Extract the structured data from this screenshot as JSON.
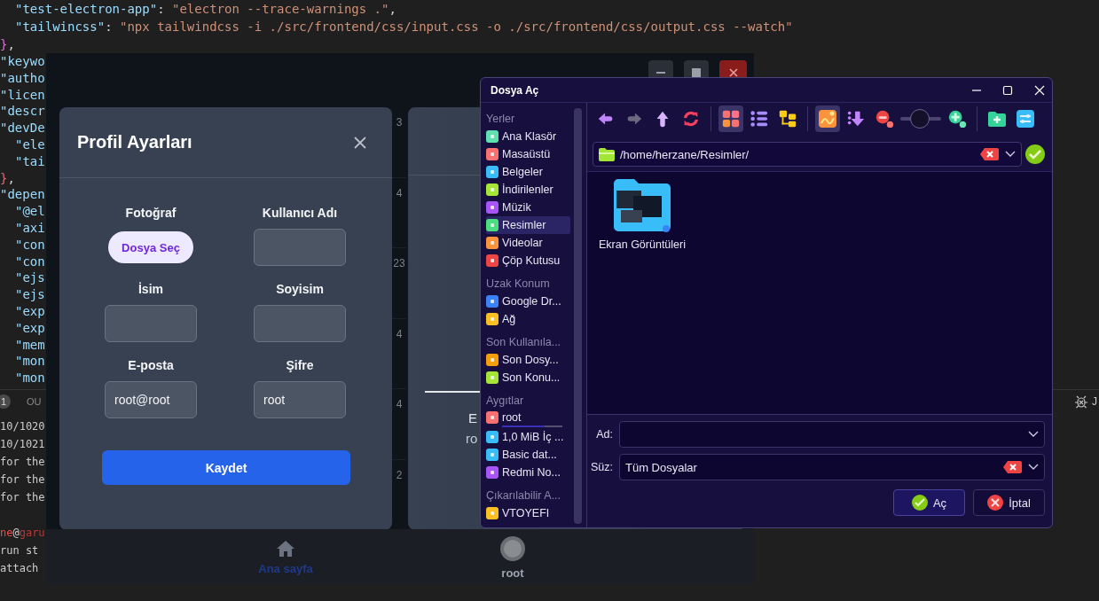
{
  "editor": {
    "code_lines": [
      {
        "indented": true,
        "segments": [
          {
            "kind": "key",
            "text": "\"test-electron-app\""
          },
          {
            "kind": "punct",
            "text": ": "
          },
          {
            "kind": "string",
            "text": "\"electron --trace-warnings .\""
          },
          {
            "kind": "punct",
            "text": ","
          }
        ]
      },
      {
        "indented": true,
        "segments": [
          {
            "kind": "key",
            "text": "\"tailwincss\""
          },
          {
            "kind": "punct",
            "text": ": "
          },
          {
            "kind": "string",
            "text": "\"npx tailwindcss -i ./src/frontend/css/input.css -o ./src/frontend/css/output.css --watch\""
          }
        ]
      },
      {
        "indented": false,
        "segments": [
          {
            "kind": "bracket_a",
            "text": "}"
          },
          {
            "kind": "punct",
            "text": ","
          }
        ]
      }
    ],
    "clipped_lines": [
      {
        "indented": false,
        "segments": [
          {
            "kind": "key",
            "text": "\"keywo"
          }
        ]
      },
      {
        "indented": false,
        "segments": [
          {
            "kind": "key",
            "text": "\"autho"
          }
        ]
      },
      {
        "indented": false,
        "segments": [
          {
            "kind": "key",
            "text": "\"licen"
          }
        ]
      },
      {
        "indented": false,
        "segments": [
          {
            "kind": "key",
            "text": "\"descr"
          }
        ]
      },
      {
        "indented": false,
        "segments": [
          {
            "kind": "key",
            "text": "\"devDe"
          }
        ]
      },
      {
        "indented": true,
        "segments": [
          {
            "kind": "key",
            "text": "\"ele"
          }
        ]
      },
      {
        "indented": true,
        "segments": [
          {
            "kind": "key",
            "text": "\"tai"
          }
        ]
      },
      {
        "indented": false,
        "segments": [
          {
            "kind": "bracket_b",
            "text": "}"
          },
          {
            "kind": "punct",
            "text": ","
          }
        ]
      },
      {
        "indented": false,
        "segments": [
          {
            "kind": "key",
            "text": "\"depen"
          }
        ]
      },
      {
        "indented": true,
        "segments": [
          {
            "kind": "key",
            "text": "\"@el"
          }
        ]
      },
      {
        "indented": true,
        "segments": [
          {
            "kind": "key",
            "text": "\"axi"
          }
        ]
      },
      {
        "indented": true,
        "segments": [
          {
            "kind": "key",
            "text": "\"con"
          }
        ]
      },
      {
        "indented": true,
        "segments": [
          {
            "kind": "key",
            "text": "\"con"
          }
        ]
      },
      {
        "indented": true,
        "segments": [
          {
            "kind": "key",
            "text": "\"ejs"
          }
        ]
      },
      {
        "indented": true,
        "segments": [
          {
            "kind": "key",
            "text": "\"ejs"
          }
        ]
      },
      {
        "indented": true,
        "segments": [
          {
            "kind": "key",
            "text": "\"exp"
          }
        ]
      },
      {
        "indented": true,
        "segments": [
          {
            "kind": "key",
            "text": "\"exp"
          }
        ]
      },
      {
        "indented": true,
        "segments": [
          {
            "kind": "key",
            "text": "\"mem"
          }
        ]
      },
      {
        "indented": true,
        "segments": [
          {
            "kind": "key",
            "text": "\"mon"
          }
        ]
      },
      {
        "indented": true,
        "segments": [
          {
            "kind": "key",
            "text": "\"mon"
          }
        ]
      }
    ],
    "panel": {
      "badge": "1",
      "tab": "OU",
      "side_label": "J"
    },
    "terminal_lines": [
      {
        "kind": "text",
        "text": "10/1020"
      },
      {
        "kind": "text",
        "text": "10/1021"
      },
      {
        "kind": "text",
        "text": "for the"
      },
      {
        "kind": "text",
        "text": "for the"
      },
      {
        "kind": "text",
        "text": "for the"
      },
      {
        "kind": "prompt",
        "user": "ne",
        "separator": "@",
        "host": "garu"
      },
      {
        "kind": "text",
        "text": "run st"
      },
      {
        "kind": "text",
        "text": "attach"
      }
    ]
  },
  "app": {
    "window_controls": [
      {
        "kind": "minimize"
      },
      {
        "kind": "maximize"
      },
      {
        "kind": "close"
      }
    ],
    "profile_modal": {
      "title": "Profil Ayarları",
      "fields": [
        {
          "kind": "file",
          "label": "Fotoğraf",
          "button": "Dosya Seç"
        },
        {
          "kind": "input",
          "label": "Kullanıcı Adı"
        },
        {
          "kind": "input",
          "label": "İsim"
        },
        {
          "kind": "input",
          "label": "Soyisim"
        },
        {
          "kind": "input",
          "label": "E-posta",
          "value": "root@root"
        },
        {
          "kind": "input",
          "label": "Şifre",
          "value": "root"
        }
      ],
      "submit": "Kaydet"
    },
    "row_numbers": [
      "3",
      "4",
      "23",
      "4",
      "4",
      "2"
    ],
    "card": {
      "texts": [
        "E",
        "ro"
      ]
    },
    "nav": [
      {
        "kind": "home",
        "label": "Ana sayfa",
        "selected": true
      },
      {
        "kind": "avatar",
        "label": "root",
        "selected": false
      }
    ]
  },
  "dialog": {
    "title": "Dosya Aç",
    "sidebar": [
      {
        "header": "Yerler",
        "items": [
          {
            "label": "Ana Klasör",
            "color": "#5ee0b0",
            "selected": false
          },
          {
            "label": "Masaüstü",
            "color": "#f87171",
            "selected": false
          },
          {
            "label": "Belgeler",
            "color": "#38bdf8",
            "selected": false
          },
          {
            "label": "İndirilenler",
            "color": "#a3e635",
            "selected": false
          },
          {
            "label": "Müzik",
            "color": "#a855f7",
            "selected": false
          },
          {
            "label": "Resimler",
            "color": "#4ade80",
            "selected": true
          },
          {
            "label": "Videolar",
            "color": "#fb923c",
            "selected": false
          },
          {
            "label": "Çöp Kutusu",
            "color": "#ef4444",
            "selected": false
          }
        ]
      },
      {
        "header": "Uzak Konum",
        "items": [
          {
            "label": "Google Dr...",
            "color": "#3b82f6",
            "selected": false
          },
          {
            "label": "Ağ",
            "color": "#fbbf24",
            "selected": false
          }
        ]
      },
      {
        "header": "Son Kullanıla...",
        "items": [
          {
            "label": "Son Dosy...",
            "color": "#f59e0b",
            "selected": false
          },
          {
            "label": "Son Konu...",
            "color": "#a3e635",
            "selected": false
          }
        ]
      },
      {
        "header": "Aygıtlar",
        "items": [
          {
            "label": "root",
            "color": "#f87171",
            "selected": false,
            "usage": {
              "level": 0.7
            }
          },
          {
            "label": "1,0 MiB İç ...",
            "color": "#38bdf8",
            "selected": false
          },
          {
            "label": "Basic dat...",
            "color": "#38bdf8",
            "selected": false
          },
          {
            "label": "Redmi No...",
            "color": "#a855f7",
            "selected": false
          }
        ]
      },
      {
        "header": "Çıkarılabilir A...",
        "items": [
          {
            "label": "VTOYEFI",
            "color": "#fbbf24",
            "selected": false
          }
        ]
      }
    ],
    "toolbar": [
      [
        {
          "kind": "back",
          "disabled": false
        },
        {
          "kind": "forward",
          "disabled": true
        },
        {
          "kind": "up",
          "disabled": false
        },
        {
          "kind": "reload",
          "disabled": false
        }
      ],
      [
        {
          "kind": "icon_view",
          "selected": true
        },
        {
          "kind": "list_view",
          "selected": false
        },
        {
          "kind": "tree_view",
          "selected": false
        }
      ],
      [
        {
          "kind": "preview",
          "on": true
        },
        {
          "kind": "sort"
        },
        {
          "kind": "zoom_out"
        },
        {
          "kind": "zoom_slider",
          "level": 0.45
        },
        {
          "kind": "zoom_in"
        }
      ],
      [
        {
          "kind": "new_folder"
        },
        {
          "kind": "settings"
        }
      ]
    ],
    "location": {
      "path": "/home/herzane/Resimler/"
    },
    "files": [
      {
        "name": "Ekran Görüntüleri"
      }
    ],
    "name_field": {
      "label": "Ad:"
    },
    "filter_field": {
      "label": "Süz:",
      "value": "Tüm Dosyalar"
    },
    "buttons": [
      {
        "kind": "accept",
        "label": "Aç"
      },
      {
        "kind": "reject",
        "label": "İptal"
      }
    ]
  }
}
